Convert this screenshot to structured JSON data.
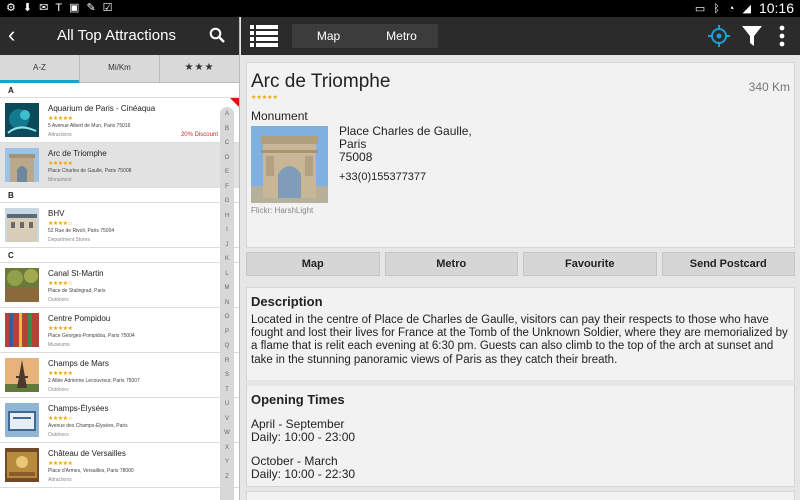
{
  "status_bar": {
    "time": "10:16",
    "icons": [
      "settings-icon",
      "download-icon",
      "gmail-icon",
      "news-icon",
      "photo-icon",
      "edit-icon",
      "check-icon",
      "battery-icon",
      "bluetooth-icon",
      "wifi-icon",
      "signal-icon"
    ]
  },
  "left_panel": {
    "title": "All Top Attractions",
    "sort_tabs": [
      {
        "label": "A-Z"
      },
      {
        "label": "Mi/Km"
      },
      {
        "label": "★★★"
      }
    ],
    "sections": [
      {
        "letter": "A",
        "items": [
          {
            "name": "Aquarium de Paris - Cinéaqua",
            "stars": "★★★★★",
            "address": "5 Avenue Albert de Mun,  Paris  75016",
            "category": "Attractions",
            "discount": "20% Discount"
          },
          {
            "name": "Arc de Triomphe",
            "stars": "★★★★★",
            "address": "Place Charles de Gaulle,  Paris  75008",
            "category": "Monument",
            "selected": true
          }
        ]
      },
      {
        "letter": "B",
        "items": [
          {
            "name": "BHV",
            "stars": "★★★★☆",
            "address": "52 Rue de Rivoli,  Paris  75004",
            "category": "Department Stores"
          }
        ]
      },
      {
        "letter": "C",
        "items": [
          {
            "name": "Canal St-Martin",
            "stars": "★★★★☆",
            "address": "Place de Stalingrad,  Paris",
            "category": "Outdoors"
          },
          {
            "name": "Centre Pompidou",
            "stars": "★★★★★",
            "address": "Place Georges-Pompidou,  Paris  75004",
            "category": "Museums"
          },
          {
            "name": "Champs de Mars",
            "stars": "★★★★★",
            "address": "2 Allée Adrienne Lecouvreur,  Paris  75007",
            "category": "Outdoors"
          },
          {
            "name": "Champs-Élysées",
            "stars": "★★★★☆",
            "address": "Avenue des Champs-Élysées,  Paris",
            "category": "Outdoors"
          },
          {
            "name": "Château de Versailles",
            "stars": "★★★★★",
            "address": "Place d'Armes, Versailles,  Paris  78000",
            "category": "Attractions"
          }
        ]
      }
    ],
    "alpha_index": [
      "A",
      "B",
      "C",
      "D",
      "E",
      "F",
      "G",
      "H",
      "I",
      "J",
      "K",
      "L",
      "M",
      "N",
      "O",
      "P",
      "Q",
      "R",
      "S",
      "T",
      "U",
      "V",
      "W",
      "X",
      "Y",
      "Z"
    ]
  },
  "top_bar": {
    "tabs": [
      "Map",
      "Metro"
    ]
  },
  "detail": {
    "title": "Arc de Triomphe",
    "distance": "340 Km",
    "stars": "★★★★★",
    "type": "Monument",
    "address_line1": "Place Charles de Gaulle,",
    "address_line2": "Paris",
    "address_line3": "75008",
    "phone": "+33(0)155377377",
    "photo_credit": "Flickr: HarshLight",
    "actions": [
      "Map",
      "Metro",
      "Favourite",
      "Send Postcard"
    ],
    "description_title": "Description",
    "description": "Located in the centre of Place de Charles de Gaulle, visitors can pay their respects to those who have fought and lost their lives for France at the Tomb of the Unknown Soldier, where they are memorialized by a flame that is relit each evening at 6:30 pm. Guests can also climb to the top of the arch at sunset and take in the stunning panoramic views of Paris as they catch their breath.",
    "hours_title": "Opening Times",
    "hours": [
      {
        "period": "April - September",
        "time": "Daily: 10:00 - 23:00"
      },
      {
        "period": "October - March",
        "time": "Daily: 10:00 - 22:30"
      }
    ]
  },
  "colors": {
    "accent": "#1a9fd6",
    "header_bg": "#2b2b2b",
    "star": "#f0a500",
    "discount": "#c62828"
  }
}
